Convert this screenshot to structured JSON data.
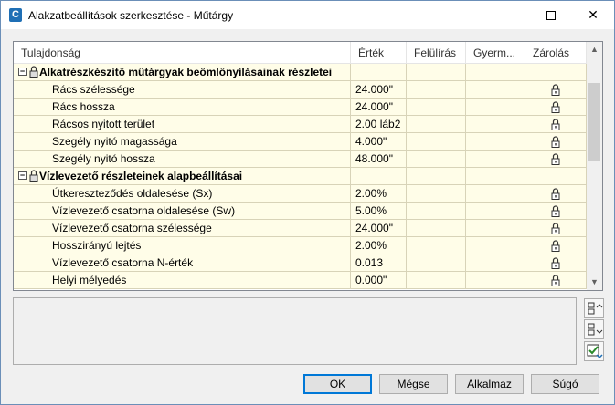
{
  "window": {
    "title": "Alakzatbeállítások szerkesztése - Műtárgy",
    "minimize": "—",
    "close": "✕"
  },
  "grid": {
    "columns": [
      "Tulajdonság",
      "Érték",
      "Felülírás",
      "Gyerm...",
      "Zárolás"
    ],
    "rows": [
      {
        "type": "category",
        "name": "Alkatrészkészítő műtárgyak beömlőnyílásainak részletei"
      },
      {
        "type": "item",
        "name": "Rács szélessége",
        "value": "24.000\"",
        "locked": true
      },
      {
        "type": "item",
        "name": "Rács hossza",
        "value": "24.000\"",
        "locked": true
      },
      {
        "type": "item",
        "name": "Rácsos nyitott terület",
        "value": "2.00 láb2",
        "locked": true
      },
      {
        "type": "item",
        "name": "Szegély nyitó magassága",
        "value": "4.000\"",
        "locked": true
      },
      {
        "type": "item",
        "name": "Szegély nyitó hossza",
        "value": "48.000\"",
        "locked": true
      },
      {
        "type": "category",
        "name": "Vízlevezető részleteinek alapbeállításai"
      },
      {
        "type": "item",
        "name": "Útkereszteződés oldalesése (Sx)",
        "value": "2.00%",
        "locked": true
      },
      {
        "type": "item",
        "name": "Vízlevezető csatorna oldalesése (Sw)",
        "value": "5.00%",
        "locked": true
      },
      {
        "type": "item",
        "name": "Vízlevezető csatorna szélessége",
        "value": "24.000\"",
        "locked": true
      },
      {
        "type": "item",
        "name": "Hosszirányú lejtés",
        "value": "2.00%",
        "locked": true
      },
      {
        "type": "item",
        "name": "Vízlevezető csatorna N-érték",
        "value": "0.013",
        "locked": true
      },
      {
        "type": "item",
        "name": "Helyi mélyedés",
        "value": "0.000\"",
        "locked": true
      }
    ]
  },
  "buttons": {
    "ok": "OK",
    "cancel": "Mégse",
    "apply": "Alkalmaz",
    "help": "Súgó"
  },
  "colors": {
    "row_bg": "#fffde8",
    "accent": "#0078d7"
  }
}
